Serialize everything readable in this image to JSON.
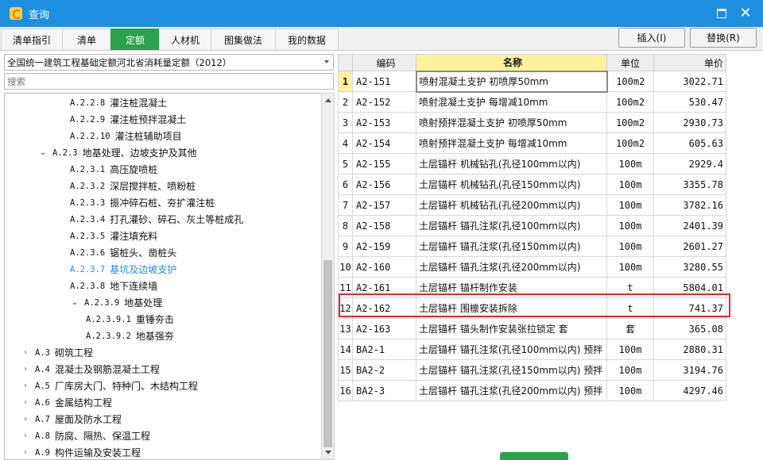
{
  "window": {
    "title": "查询"
  },
  "tabs": [
    {
      "label": "清单指引",
      "active": false
    },
    {
      "label": "清单",
      "active": false
    },
    {
      "label": "定额",
      "active": true
    },
    {
      "label": "人材机",
      "active": false
    },
    {
      "label": "图集做法",
      "active": false
    },
    {
      "label": "我的数据",
      "active": false
    }
  ],
  "toolbar": {
    "insert_label": "插入(I)",
    "replace_label": "替换(R)"
  },
  "left": {
    "dropdown_value": "全国统一建筑工程基础定额河北省消耗量定额（2012）",
    "search_placeholder": "搜索",
    "tree": [
      {
        "code": "A.2.2.8",
        "label": "灌注桩混凝土",
        "level": 4,
        "toggle": ""
      },
      {
        "code": "A.2.2.9",
        "label": "灌注桩预拌混凝土",
        "level": 4,
        "toggle": ""
      },
      {
        "code": "A.2.2.10",
        "label": "灌注桩辅助项目",
        "level": 4,
        "toggle": ""
      },
      {
        "code": "A.2.3",
        "label": "地基处理、边坡支护及其他",
        "level": 3,
        "toggle": "expanded"
      },
      {
        "code": "A.2.3.1",
        "label": "高压旋喷桩",
        "level": 4,
        "toggle": ""
      },
      {
        "code": "A.2.3.2",
        "label": "深层搅拌桩、喷粉桩",
        "level": 4,
        "toggle": ""
      },
      {
        "code": "A.2.3.3",
        "label": "振冲碎石桩、夯扩灌注桩",
        "level": 4,
        "toggle": ""
      },
      {
        "code": "A.2.3.4",
        "label": "打孔灌砂、碎石、灰土等桩成孔",
        "level": 4,
        "toggle": ""
      },
      {
        "code": "A.2.3.5",
        "label": "灌注填充料",
        "level": 4,
        "toggle": ""
      },
      {
        "code": "A.2.3.6",
        "label": "锯桩头、凿桩头",
        "level": 4,
        "toggle": ""
      },
      {
        "code": "A.2.3.7",
        "label": "基坑及边坡支护",
        "level": 4,
        "toggle": "",
        "selected": true
      },
      {
        "code": "A.2.3.8",
        "label": "地下连续墙",
        "level": 4,
        "toggle": ""
      },
      {
        "code": "A.2.3.9",
        "label": "地基处理",
        "level": 4,
        "toggle": "expanded"
      },
      {
        "code": "A.2.3.9.1",
        "label": "重锤夯击",
        "level": 5,
        "toggle": ""
      },
      {
        "code": "A.2.3.9.2",
        "label": "地基强夯",
        "level": 5,
        "toggle": ""
      },
      {
        "code": "A.3",
        "label": "砌筑工程",
        "level": 2,
        "toggle": "collapsed"
      },
      {
        "code": "A.4",
        "label": "混凝土及钢筋混凝土工程",
        "level": 2,
        "toggle": "collapsed"
      },
      {
        "code": "A.5",
        "label": "厂库房大门、特种门、木结构工程",
        "level": 2,
        "toggle": "collapsed"
      },
      {
        "code": "A.6",
        "label": "金属结构工程",
        "level": 2,
        "toggle": "collapsed"
      },
      {
        "code": "A.7",
        "label": "屋面及防水工程",
        "level": 2,
        "toggle": "collapsed"
      },
      {
        "code": "A.8",
        "label": "防腐、隔热、保温工程",
        "level": 2,
        "toggle": "collapsed"
      },
      {
        "code": "A.9",
        "label": "构件运输及安装工程",
        "level": 2,
        "toggle": "collapsed"
      }
    ]
  },
  "grid": {
    "headers": {
      "idx": "",
      "code": "编码",
      "name": "名称",
      "unit": "单位",
      "price": "单价"
    },
    "highlighted_row": 12,
    "rows": [
      {
        "idx": "1",
        "code": "A2-151",
        "name": "喷射混凝土支护 初喷厚50mm",
        "unit": "100m2",
        "price": "3022.71"
      },
      {
        "idx": "2",
        "code": "A2-152",
        "name": "喷射混凝土支护 每增减10mm",
        "unit": "100m2",
        "price": "530.47"
      },
      {
        "idx": "3",
        "code": "A2-153",
        "name": "喷射预拌混凝土支护 初喷厚50mm",
        "unit": "100m2",
        "price": "2930.73"
      },
      {
        "idx": "4",
        "code": "A2-154",
        "name": "喷射预拌混凝土支护 每增减10mm",
        "unit": "100m2",
        "price": "605.63"
      },
      {
        "idx": "5",
        "code": "A2-155",
        "name": "土层锚杆 机械钻孔(孔径100mm以内)",
        "unit": "100m",
        "price": "2929.4"
      },
      {
        "idx": "6",
        "code": "A2-156",
        "name": "土层锚杆 机械钻孔(孔径150mm以内)",
        "unit": "100m",
        "price": "3355.78"
      },
      {
        "idx": "7",
        "code": "A2-157",
        "name": "土层锚杆 机械钻孔(孔径200mm以内)",
        "unit": "100m",
        "price": "3782.16"
      },
      {
        "idx": "8",
        "code": "A2-158",
        "name": "土层锚杆 锚孔注浆(孔径100mm以内)",
        "unit": "100m",
        "price": "2401.39"
      },
      {
        "idx": "9",
        "code": "A2-159",
        "name": "土层锚杆 锚孔注浆(孔径150mm以内)",
        "unit": "100m",
        "price": "2601.27"
      },
      {
        "idx": "10",
        "code": "A2-160",
        "name": "土层锚杆 锚孔注浆(孔径200mm以内)",
        "unit": "100m",
        "price": "3280.55"
      },
      {
        "idx": "11",
        "code": "A2-161",
        "name": "土层锚杆 锚杆制作安装",
        "unit": "t",
        "price": "5804.01"
      },
      {
        "idx": "12",
        "code": "A2-162",
        "name": "土层锚杆 围檩安装拆除",
        "unit": "t",
        "price": "741.37"
      },
      {
        "idx": "13",
        "code": "A2-163",
        "name": "土层锚杆 锚头制作安装张拉锁定 套",
        "unit": "套",
        "price": "365.08"
      },
      {
        "idx": "14",
        "code": "BA2-1",
        "name": "土层锚杆 锚孔注浆(孔径100mm以内) 预拌",
        "unit": "100m",
        "price": "2880.31"
      },
      {
        "idx": "15",
        "code": "BA2-2",
        "name": "土层锚杆 锚孔注浆(孔径150mm以内) 预拌",
        "unit": "100m",
        "price": "3194.76"
      },
      {
        "idx": "16",
        "code": "BA2-3",
        "name": "土层锚杆 锚孔注浆(孔径200mm以内) 预拌",
        "unit": "100m",
        "price": "4297.46"
      }
    ]
  },
  "colors": {
    "titlebar": "#1e8fe0",
    "active_tab": "#2aa14a",
    "header_highlight": "#fff29a",
    "highlight_border": "#e8262a"
  }
}
